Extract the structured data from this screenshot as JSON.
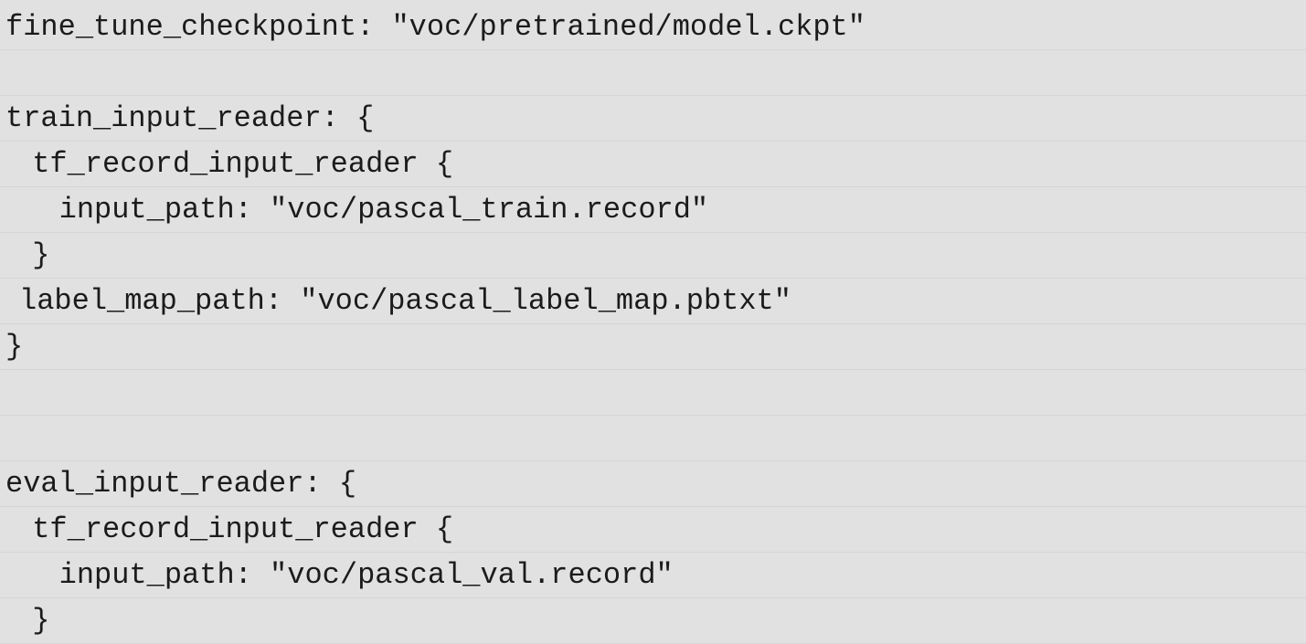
{
  "code": {
    "lines": [
      "fine_tune_checkpoint: \"voc/pretrained/model.ckpt\"",
      "",
      "train_input_reader: {",
      " tf_record_input_reader {",
      "   input_path: \"voc/pascal_train.record\"",
      " }",
      "label_map_path: \"voc/pascal_label_map.pbtxt\"",
      "}",
      "",
      "",
      "eval_input_reader: {",
      " tf_record_input_reader {",
      "   input_path: \"voc/pascal_val.record\"",
      " }"
    ]
  }
}
